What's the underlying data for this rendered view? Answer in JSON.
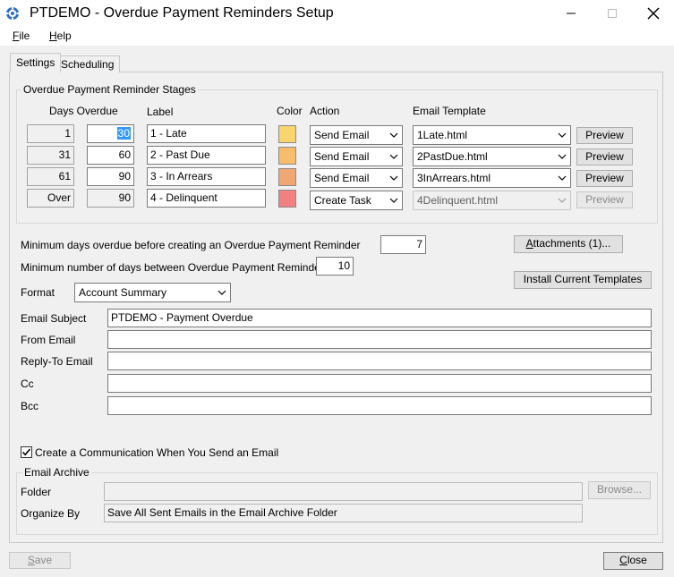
{
  "window": {
    "title": "PTDEMO - Overdue Payment Reminders Setup",
    "icon": "gear-icon"
  },
  "menu": {
    "file": {
      "underline": "F",
      "rest": "ile"
    },
    "help": {
      "underline": "H",
      "rest": "elp"
    }
  },
  "tabs": {
    "settings": "Settings",
    "scheduling": "Scheduling"
  },
  "stages": {
    "group_caption": "Overdue Payment Reminder Stages",
    "headers": {
      "days_overdue": "Days Overdue",
      "label": "Label",
      "color": "Color",
      "action": "Action",
      "email_template": "Email Template"
    },
    "rows": [
      {
        "from": "1",
        "to": "30",
        "label": "1 - Late",
        "color": "#f9d56e",
        "action": "Send Email",
        "template": "1Late.html",
        "preview": "Preview"
      },
      {
        "from": "31",
        "to": "60",
        "label": "2 - Past Due",
        "color": "#f7bd6c",
        "action": "Send Email",
        "template": "2PastDue.html",
        "preview": "Preview"
      },
      {
        "from": "61",
        "to": "90",
        "label": "3 - In Arrears",
        "color": "#f0a872",
        "action": "Send Email",
        "template": "3InArrears.html",
        "preview": "Preview"
      },
      {
        "from": "Over",
        "to": "90",
        "label": "4 - Delinquent",
        "color": "#f28080",
        "action": "Create Task",
        "template": "4Delinquent.html",
        "preview": "Preview"
      }
    ]
  },
  "settings": {
    "min_days_label": "Minimum days overdue before creating an Overdue Payment Reminder",
    "min_days_value": "7",
    "min_between_label": "Minimum number of days between Overdue Payment Reminders",
    "min_between_value": "10",
    "format_label": "Format",
    "format_value": "Account Summary",
    "attachments_button": "Attachments (1)...",
    "install_button": "Install Current Templates"
  },
  "email": {
    "subject_label": "Email Subject",
    "subject_value": "PTDEMO - Payment Overdue",
    "from_label": "From Email",
    "from_value": "",
    "reply_to_label": "Reply-To Email",
    "reply_to_value": "",
    "cc_label": "Cc",
    "cc_value": "",
    "bcc_label": "Bcc",
    "bcc_value": ""
  },
  "communication": {
    "checkbox_label": "Create a Communication When You Send an Email",
    "checked": true
  },
  "archive": {
    "group_caption": "Email Archive",
    "folder_label": "Folder",
    "folder_value": "",
    "browse_button": "Browse...",
    "organize_label": "Organize By",
    "organize_value": "Save All Sent Emails in the Email Archive Folder"
  },
  "footer": {
    "save_button": "Save",
    "close_button": "Close"
  }
}
